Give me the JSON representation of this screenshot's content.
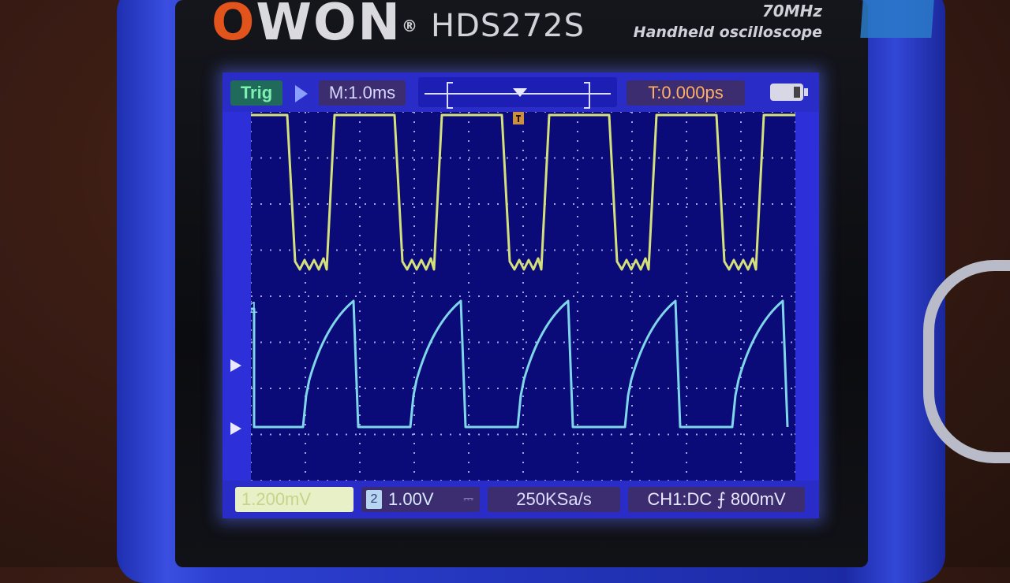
{
  "device": {
    "brand": "OWON",
    "registered_mark": "®",
    "model": "HDS272S",
    "bandwidth": "70MHz",
    "product_name": "Handheld oscilloscope"
  },
  "screen": {
    "top_bar": {
      "trigger_status": "Trig",
      "timebase": "M:1.0ms",
      "trigger_time": "T:0.000ps"
    },
    "bottom_bar": {
      "ch1_scale": "1.200mV",
      "ch2_number": "2",
      "ch2_scale": "1.00V",
      "ch2_coupling": "⎓",
      "sample_rate": "250KSa/s",
      "trigger_source": "CH1:DC ⨍ 800mV"
    },
    "markers": {
      "ch2_level": "1",
      "trigger_position_icon": "trigger-marker-icon"
    }
  },
  "colors": {
    "ch1_trace": "#d4e07a",
    "ch2_trace": "#7fd6e8",
    "grid_bg": "#0a0a78",
    "grid_dots": "#c8c8ff",
    "screen_frame": "#2d2fd8",
    "brand_orange": "#e2541b"
  }
}
